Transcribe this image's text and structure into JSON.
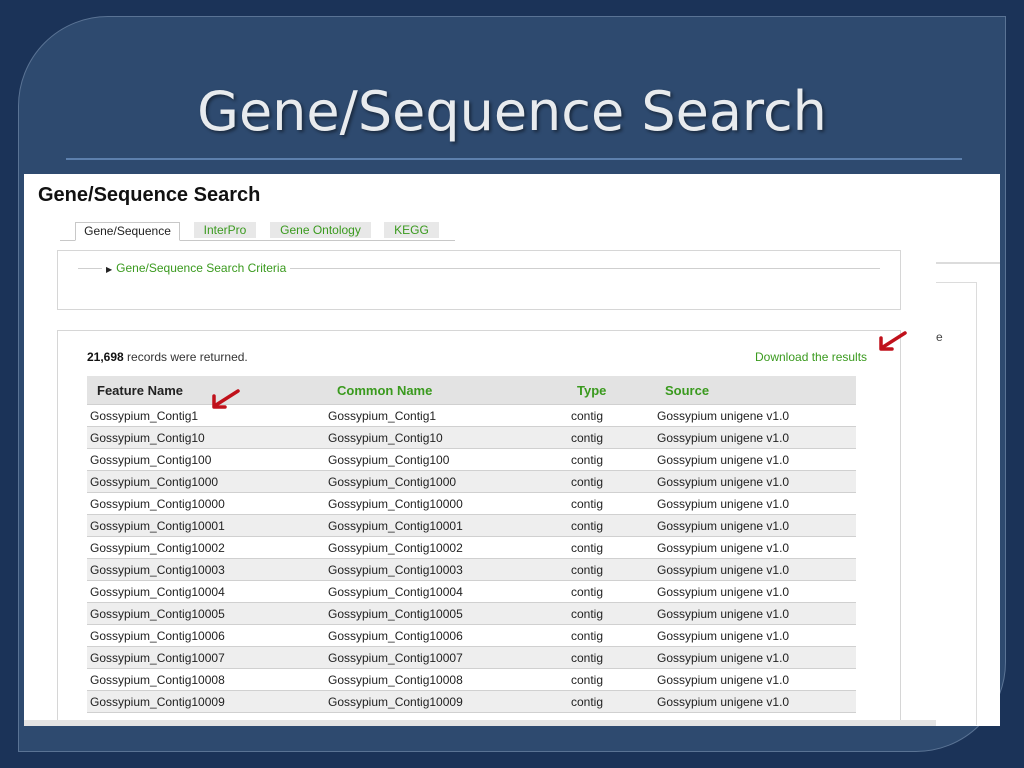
{
  "slide": {
    "title": "Gene/Sequence Search"
  },
  "page": {
    "heading": "Gene/Sequence Search"
  },
  "tabs": [
    {
      "label": "Gene/Sequence",
      "active": true
    },
    {
      "label": "InterPro",
      "active": false
    },
    {
      "label": "Gene Ontology",
      "active": false
    },
    {
      "label": "KEGG",
      "active": false
    }
  ],
  "criteria": {
    "legend": "Gene/Sequence Search Criteria"
  },
  "results": {
    "count": "21,698",
    "count_suffix": " records were returned.",
    "download_label": "Download the results",
    "columns": [
      "Feature Name",
      "Common Name",
      "Type",
      "Source"
    ],
    "rows": [
      [
        "Gossypium_Contig1",
        "Gossypium_Contig1",
        "contig",
        "Gossypium unigene v1.0"
      ],
      [
        "Gossypium_Contig10",
        "Gossypium_Contig10",
        "contig",
        "Gossypium unigene v1.0"
      ],
      [
        "Gossypium_Contig100",
        "Gossypium_Contig100",
        "contig",
        "Gossypium unigene v1.0"
      ],
      [
        "Gossypium_Contig1000",
        "Gossypium_Contig1000",
        "contig",
        "Gossypium unigene v1.0"
      ],
      [
        "Gossypium_Contig10000",
        "Gossypium_Contig10000",
        "contig",
        "Gossypium unigene v1.0"
      ],
      [
        "Gossypium_Contig10001",
        "Gossypium_Contig10001",
        "contig",
        "Gossypium unigene v1.0"
      ],
      [
        "Gossypium_Contig10002",
        "Gossypium_Contig10002",
        "contig",
        "Gossypium unigene v1.0"
      ],
      [
        "Gossypium_Contig10003",
        "Gossypium_Contig10003",
        "contig",
        "Gossypium unigene v1.0"
      ],
      [
        "Gossypium_Contig10004",
        "Gossypium_Contig10004",
        "contig",
        "Gossypium unigene v1.0"
      ],
      [
        "Gossypium_Contig10005",
        "Gossypium_Contig10005",
        "contig",
        "Gossypium unigene v1.0"
      ],
      [
        "Gossypium_Contig10006",
        "Gossypium_Contig10006",
        "contig",
        "Gossypium unigene v1.0"
      ],
      [
        "Gossypium_Contig10007",
        "Gossypium_Contig10007",
        "contig",
        "Gossypium unigene v1.0"
      ],
      [
        "Gossypium_Contig10008",
        "Gossypium_Contig10008",
        "contig",
        "Gossypium unigene v1.0"
      ],
      [
        "Gossypium_Contig10009",
        "Gossypium_Contig10009",
        "contig",
        "Gossypium unigene v1.0"
      ]
    ]
  },
  "overflow_text": "e",
  "colors": {
    "slide_bg": "#1b3358",
    "panel": "#2e4a6f",
    "link_green": "#3a9a1e",
    "arrow_red": "#c0111b"
  }
}
